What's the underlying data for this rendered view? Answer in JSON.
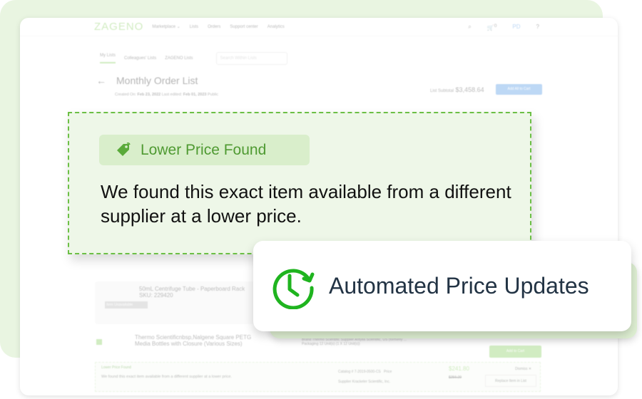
{
  "nav": {
    "logo": "ZAGENO",
    "items": [
      "Marketplace ⌄",
      "Lists",
      "Orders",
      "Support center",
      "Analytics"
    ],
    "cart_count": "0",
    "avatar": "PD"
  },
  "tabs": {
    "items": [
      "My Lists",
      "Colleagues' Lists",
      "ZAGENO Lists"
    ],
    "search_placeholder": "Search Within Lists"
  },
  "list": {
    "title": "Monthly Order List",
    "created_label": "Created On:",
    "created": "Feb 23, 2022",
    "edited_label": "Last edited:",
    "edited": "Feb 01, 2023",
    "visibility": "Public",
    "subtotal_label": "List Subtotal",
    "subtotal": "$3,458.64",
    "add_all": "Add All to Cart"
  },
  "items": [
    {
      "name": "50mL Centrifuge Tube - Paperboard Rack",
      "sku": "SKU: 229420",
      "status": "Item Unavailable"
    },
    {
      "name": "Thermo Scientificnbsp,Nalgene Square PETG Media Bottles with Closure (Various Sizes)",
      "brand_label": "Brand",
      "brand": "Thermo Scientific",
      "supplier_label": "Supplier",
      "supplier": "Antylia Scientific, US (formerly ...",
      "packaging_label": "Packaging",
      "packaging": "12 Unit(s) (1 X 12 Unit(s))",
      "add_to_cart": "Add to Cart"
    }
  ],
  "lower_price": {
    "badge": "Lower Price Found",
    "message": "We found this exact item available from a different supplier at a lower price.",
    "catalog_label": "Catalog #",
    "catalog": "7-2019-0500-CS",
    "supplier_label": "Supplier",
    "supplier": "Krackeler Scientific, Inc.",
    "price_label": "Price",
    "price": "$241.80",
    "old_price": "$256.20",
    "dismiss": "Dismiss",
    "replace": "Replace Item in List"
  },
  "callout": {
    "badge": "Lower Price Found",
    "message": "We found this exact item available from a different supplier at a lower price."
  },
  "feature": {
    "label": "Automated Price Updates"
  },
  "colors": {
    "accent": "#6cbf45",
    "clock": "#1fb41f",
    "bg": "#e9f5e1"
  }
}
